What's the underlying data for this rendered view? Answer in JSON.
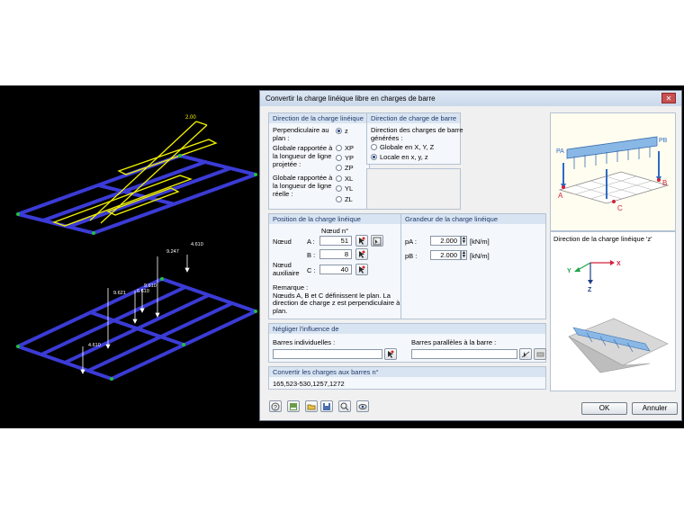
{
  "dialog": {
    "title": "Convertir la charge linéique libre en charges de barre",
    "close_glyph": "✕"
  },
  "direction": {
    "header": "Direction de la charge linéique",
    "perp_label": "Perpendiculaire au\nplan :",
    "projected_label": "Globale rapportée à\nla longueur de ligne\nprojetée :",
    "real_label": "Globale rapportée à\nla longueur de ligne\nréelle :",
    "options": [
      "z",
      "XP",
      "YP",
      "ZP",
      "XL",
      "YL",
      "ZL"
    ],
    "selected": "z"
  },
  "bar_direction": {
    "header": "Direction de charge de barre",
    "label": "Direction des charges de barre\ngénérées :",
    "options": [
      "Globale en X, Y, Z",
      "Locale en x, y, z"
    ],
    "selected": "Locale en x, y, z"
  },
  "position": {
    "header": "Position de la charge linéique",
    "node_col": "Nœud n°",
    "node_label": "Nœud",
    "aux_label": "Nœud\nauxiliaire",
    "a_label": "A :",
    "b_label": "B :",
    "c_label": "C :",
    "a_value": "51",
    "b_value": "8",
    "c_value": "40",
    "remark": "Remarque :\nNœuds A, B et C définissent le plan. La\ndirection de charge z est perpendiculaire à ce\nplan."
  },
  "magnitude": {
    "header": "Grandeur de la charge linéique",
    "pa_label": "pA :",
    "pb_label": "pB :",
    "pa_value": "2.000",
    "pb_value": "2.000",
    "unit": "[kN/m]"
  },
  "neglect": {
    "header": "Négliger l'influence de",
    "individual_label": "Barres individuelles :",
    "parallel_label": "Barres parallèles à la barre :"
  },
  "convert": {
    "header": "Convertir les charges aux barres n°",
    "value": "165,523-530,1257,1272"
  },
  "diagram": {
    "pa": "PA",
    "pb": "PB",
    "a": "A",
    "b": "B",
    "c": "C",
    "direction_title": "Direction de la charge linéique 'z'",
    "axis_x": "X",
    "axis_y": "Y",
    "axis_z": "Z"
  },
  "viewport": {
    "load_top": "2.00",
    "loads": [
      "9.247",
      "4.610",
      "9.621",
      "9.610",
      "6.610",
      "4.610"
    ]
  },
  "buttons": {
    "ok": "OK",
    "cancel": "Annuler"
  },
  "colors": {
    "beam": "#3b3bd6",
    "load": "#f2f200",
    "support": "#1fbf3a"
  }
}
